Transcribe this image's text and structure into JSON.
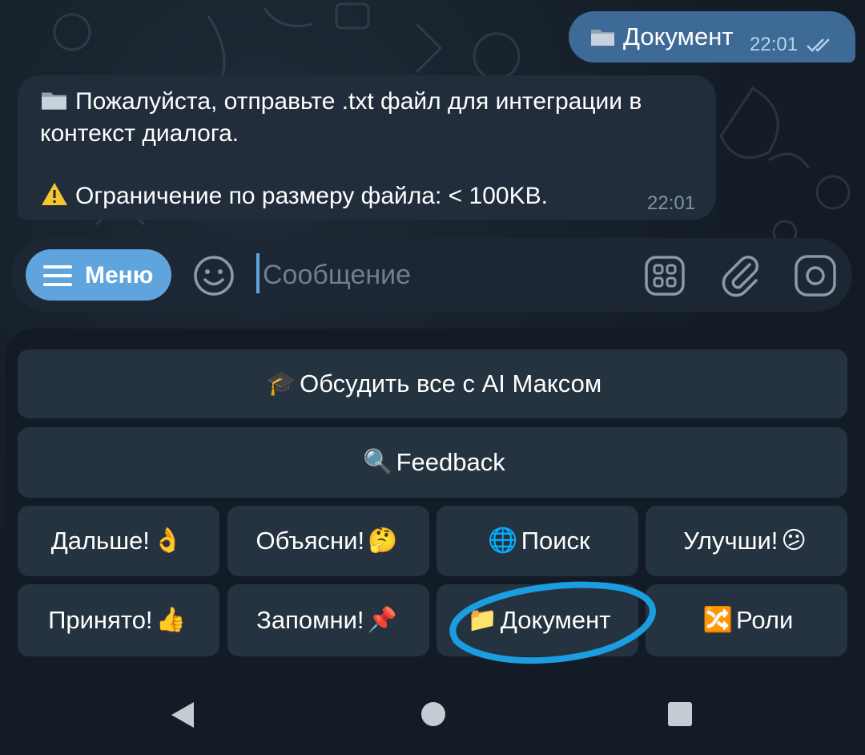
{
  "chat": {
    "outgoing": {
      "text": "Документ",
      "time": "22:01"
    },
    "incoming": {
      "line1": "Пожалуйста, отправьте .txt файл для интеграции в",
      "line2": "контекст диалога.",
      "line3": "Ограничение по размеру файла: < 100KB.",
      "time": "22:01"
    }
  },
  "input_bar": {
    "menu_label": "Меню",
    "placeholder": "Сообщение"
  },
  "keyboard": {
    "row1": {
      "label": "Обсудить все с AI Максом",
      "emoji": "🎓"
    },
    "row2": {
      "label": "Feedback",
      "emoji": "🔍"
    },
    "row3": [
      {
        "label": "Дальше!",
        "emoji": "👌"
      },
      {
        "label": "Объясни!",
        "emoji": "🤔"
      },
      {
        "label": "Поиск",
        "emoji": "🌐"
      },
      {
        "label": "Улучши!",
        "emoji": "😕"
      }
    ],
    "row4": [
      {
        "label": "Принято!",
        "emoji": "👍"
      },
      {
        "label": "Запомни!",
        "emoji": "📌"
      },
      {
        "label": "Документ",
        "emoji": "📁"
      },
      {
        "label": "Роли",
        "emoji": "🔀"
      }
    ]
  },
  "colors": {
    "accent": "#5fa4dc",
    "outgoing_bubble": "#3d6a96",
    "incoming_bubble": "#212d3b",
    "annotation": "#1a9ee0"
  }
}
